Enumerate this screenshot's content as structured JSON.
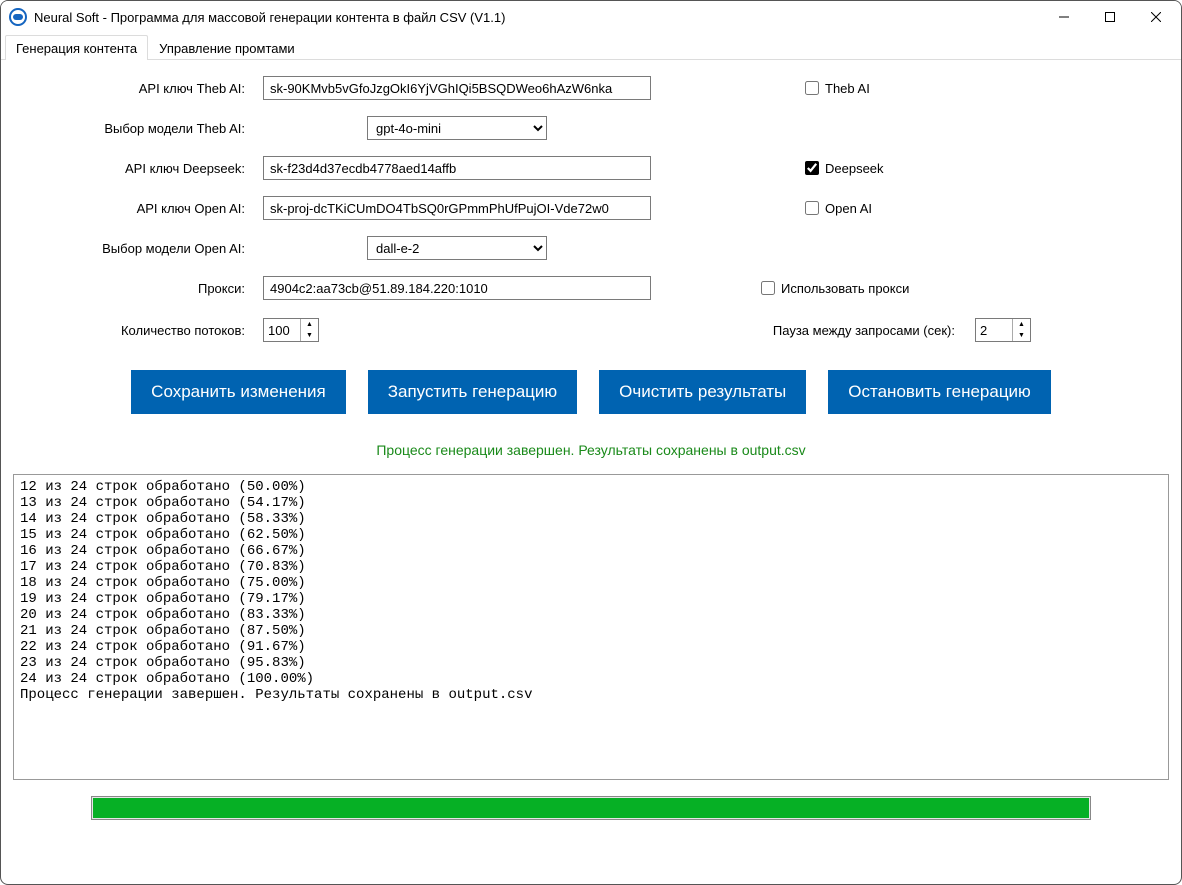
{
  "window": {
    "title": "Neural Soft - Программа для массовой генерации контента в файл CSV (V1.1)"
  },
  "tabs": {
    "active": "Генерация контента",
    "inactive": "Управление промтами"
  },
  "labels": {
    "api_theb": "API ключ Theb AI:",
    "model_theb": "Выбор модели Theb AI:",
    "api_deepseek": "API ключ Deepseek:",
    "api_openai": "API ключ Open AI:",
    "model_openai": "Выбор модели Open AI:",
    "proxy": "Прокси:",
    "threads": "Количество потоков:",
    "pause": "Пауза между запросами (сек):"
  },
  "values": {
    "api_theb": "sk-90KMvb5vGfoJzgOkI6YjVGhIQi5BSQDWeo6hAzW6nka",
    "model_theb": "gpt-4o-mini",
    "api_deepseek": "sk-f23d4d37ecdb4778aed14affb",
    "api_openai": "sk-proj-dcTKiCUmDO4TbSQ0rGPmmPhUfPujOI-Vde72w0",
    "model_openai": "dall-e-2",
    "proxy": "4904c2:aa73cb@51.89.184.220:1010",
    "threads": "100",
    "pause": "2"
  },
  "checks": {
    "theb": "Theb AI",
    "deepseek": "Deepseek",
    "openai": "Open AI",
    "use_proxy": "Использовать прокси"
  },
  "buttons": {
    "save": "Сохранить изменения",
    "start": "Запустить генерацию",
    "clear": "Очистить результаты",
    "stop": "Остановить генерацию"
  },
  "status_line": "Процесс генерации завершен. Результаты сохранены в output.csv",
  "console_lines": [
    "12 из 24 строк обработано (50.00%)",
    "13 из 24 строк обработано (54.17%)",
    "14 из 24 строк обработано (58.33%)",
    "15 из 24 строк обработано (62.50%)",
    "16 из 24 строк обработано (66.67%)",
    "17 из 24 строк обработано (70.83%)",
    "18 из 24 строк обработано (75.00%)",
    "19 из 24 строк обработано (79.17%)",
    "20 из 24 строк обработано (83.33%)",
    "21 из 24 строк обработано (87.50%)",
    "22 из 24 строк обработано (91.67%)",
    "23 из 24 строк обработано (95.83%)",
    "24 из 24 строк обработано (100.00%)",
    "Процесс генерации завершен. Результаты сохранены в output.csv"
  ],
  "progress_pct": 100
}
